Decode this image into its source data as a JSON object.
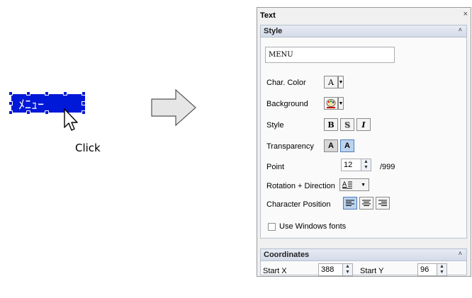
{
  "left": {
    "selected_text": "ﾒﾆｭｰ",
    "click_label": "Click"
  },
  "panel": {
    "title": "Text",
    "close_glyph": "×",
    "style_group": {
      "title": "Style",
      "collapse_glyph": "˄",
      "text_value": "MENU",
      "char_color_label": "Char. Color",
      "char_color_glyph": "A",
      "background_label": "Background",
      "style_label": "Style",
      "bold_glyph": "B",
      "shadow_glyph": "S",
      "italic_glyph": "I",
      "transparency_label": "Transparency",
      "transparency_glyph": "A",
      "point_label": "Point",
      "point_value": "12",
      "point_max": "/999",
      "rotation_label": "Rotation + Direction",
      "char_position_label": "Character Position",
      "use_windows_fonts_label": "Use Windows fonts",
      "use_windows_fonts_checked": false
    },
    "coordinates_group": {
      "title": "Coordinates",
      "collapse_glyph": "˄",
      "start_x_label": "Start X",
      "start_x_value": "388",
      "start_y_label": "Start Y",
      "start_y_value": "96"
    }
  },
  "colors": {
    "selection": "#0018d8",
    "panel_bg": "#f0f0f0",
    "pressed": "#bcd3ee"
  }
}
